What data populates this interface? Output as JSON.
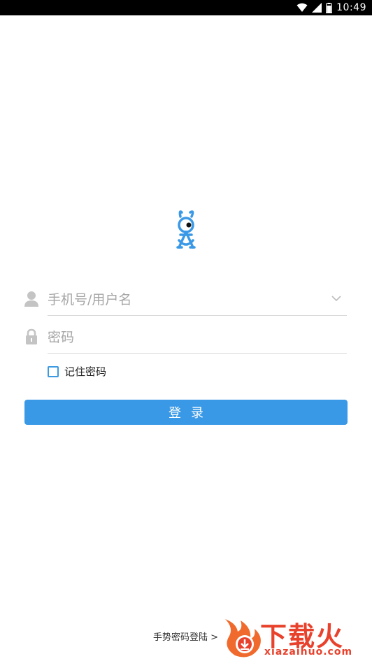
{
  "status_bar": {
    "time": "10:49",
    "icons": [
      "wifi-icon",
      "signal-icon",
      "battery-icon"
    ]
  },
  "app": {
    "logo": "ant-logo-icon",
    "brand_color": "#3a99e6"
  },
  "login_form": {
    "username": {
      "placeholder": "手机号/用户名",
      "value": ""
    },
    "password": {
      "placeholder": "密码",
      "value": ""
    },
    "remember_label": "记住密码",
    "remember_checked": false,
    "submit_label": "登录"
  },
  "footer": {
    "gesture_login": "手势密码登陆 >"
  },
  "watermark": {
    "title": "下载火",
    "url": "xiazaihuo.com",
    "color": "#e8412c"
  }
}
